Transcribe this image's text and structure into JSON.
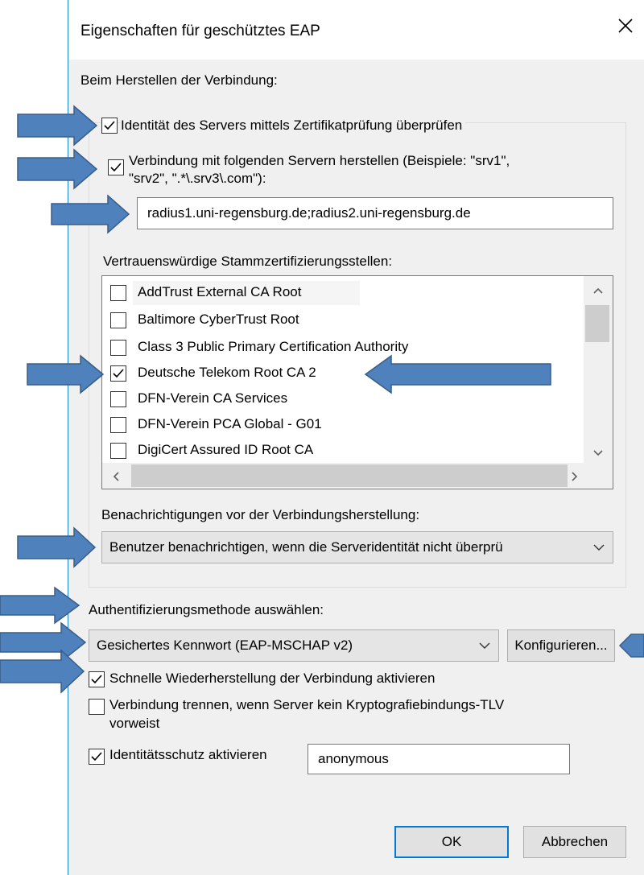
{
  "dialog": {
    "title": "Eigenschaften für geschütztes EAP",
    "close_label": "✕"
  },
  "connect_section": {
    "heading": "Beim Herstellen der Verbindung:",
    "verify_identity": {
      "label": "Identität des Servers mittels Zertifikatprüfung überprüfen",
      "checked": true
    },
    "connect_servers": {
      "label_line1": "Verbindung mit folgenden Servern herstellen (Beispiele: \"srv1\",",
      "label_line2": "\"srv2\", \".*\\.srv3\\.com\"):",
      "checked": true
    },
    "server_list_value": "radius1.uni-regensburg.de;radius2.uni-regensburg.de",
    "trusted_ca_heading": "Vertrauenswürdige Stammzertifizierungsstellen:",
    "trusted_cas": [
      {
        "label": "AddTrust External CA Root",
        "checked": false
      },
      {
        "label": "Baltimore CyberTrust Root",
        "checked": false
      },
      {
        "label": "Class 3 Public Primary Certification Authority",
        "checked": false
      },
      {
        "label": "Deutsche Telekom Root CA 2",
        "checked": true
      },
      {
        "label": "DFN-Verein CA Services",
        "checked": false
      },
      {
        "label": "DFN-Verein PCA Global - G01",
        "checked": false
      },
      {
        "label": "DigiCert Assured ID Root CA",
        "checked": false
      }
    ],
    "notifications_heading": "Benachrichtigungen vor der Verbindungsherstellung:",
    "notifications_value": "Benutzer benachrichtigen, wenn die Serveridentität nicht überprü"
  },
  "auth": {
    "heading": "Authentifizierungsmethode auswählen:",
    "method_value": "Gesichertes Kennwort (EAP-MSCHAP v2)",
    "configure_label": "Konfigurieren...",
    "fast_reconnect": {
      "label": "Schnelle Wiederherstellung der Verbindung aktivieren",
      "checked": true
    },
    "disconnect_tlv": {
      "label_line1": "Verbindung trennen, wenn Server kein Kryptografiebindungs-TLV",
      "label_line2": "vorweist",
      "checked": false
    },
    "identity_privacy": {
      "label": "Identitätsschutz aktivieren",
      "checked": true
    },
    "identity_value": "anonymous"
  },
  "buttons": {
    "ok_label": "OK",
    "cancel_label": "Abbrechen"
  },
  "colors": {
    "annotation_arrow_fill": "#4f81bd",
    "annotation_arrow_stroke": "#385d8a",
    "dialog_border": "#1883d7",
    "default_button_border": "#0078d7"
  }
}
